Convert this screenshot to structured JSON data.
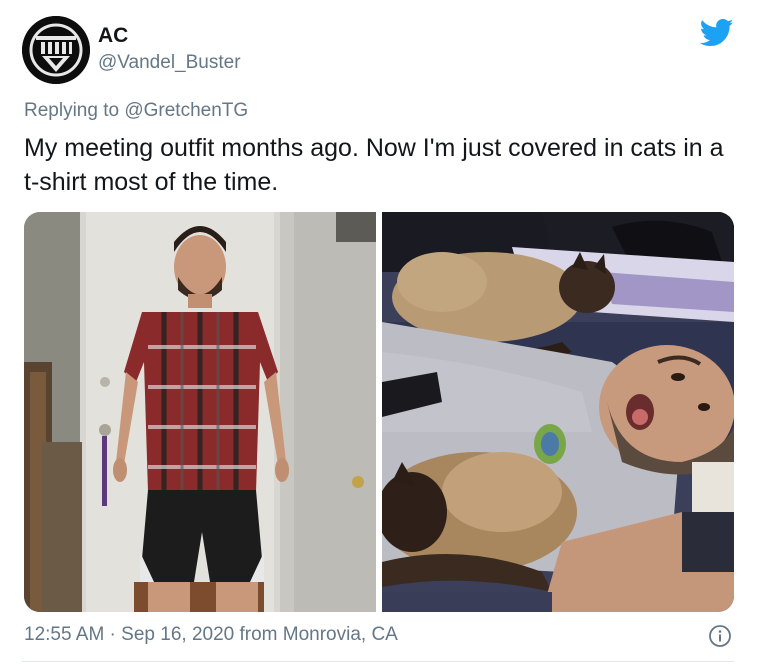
{
  "user": {
    "display_name": "AC",
    "handle": "@Vandel_Buster"
  },
  "reply": {
    "prefix": "Replying to",
    "to_handle": "@GretchenTG"
  },
  "tweet": {
    "text": "My meeting outfit months ago. Now I'm just covered in cats in a t-shirt most of the time."
  },
  "media": [
    {
      "kind": "photo",
      "subject": "man-in-plaid-shirt"
    },
    {
      "kind": "photo",
      "subject": "selfie-with-siamese-cats"
    }
  ],
  "meta": {
    "timestamp": "12:55 AM · Sep 16, 2020 from Monrovia, CA"
  },
  "icons": {
    "brand": "twitter-bird-icon",
    "info": "info-icon",
    "avatar": "lantern-emblem-icon"
  },
  "colors": {
    "twitter_blue": "#1da1f2",
    "secondary_text": "#657786",
    "primary_text": "#14171a"
  }
}
